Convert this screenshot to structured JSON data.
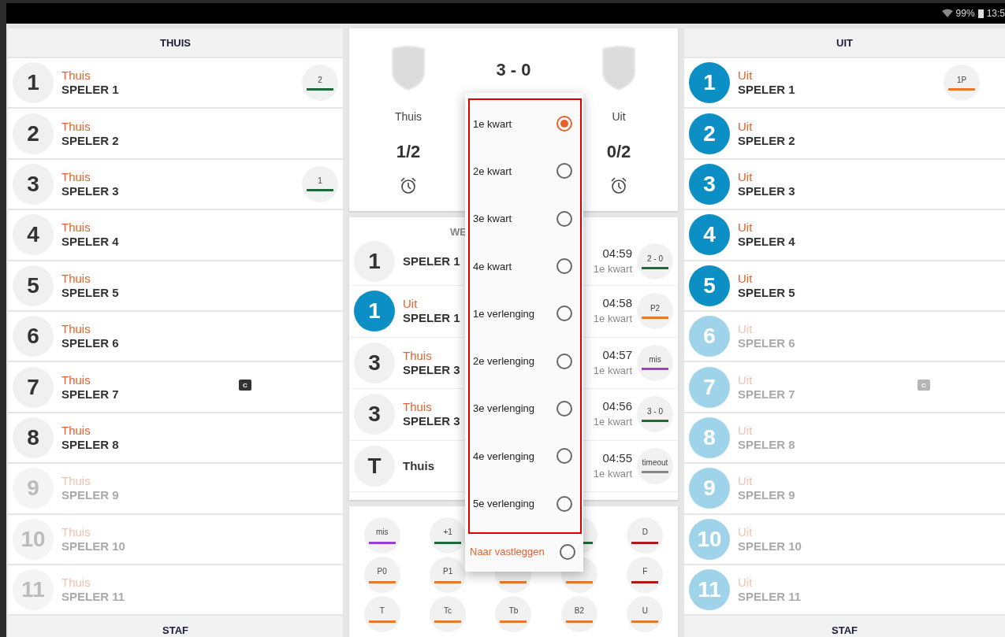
{
  "status_bar": {
    "battery": "99%",
    "time": "13:5"
  },
  "home": {
    "kind": "home",
    "title": "THUIS",
    "footer": "STAF",
    "players": [
      {
        "number": "1",
        "team": "Thuis",
        "name": "SPELER 1",
        "active": true,
        "badge": {
          "label": "2",
          "color": "#1d6b3b"
        }
      },
      {
        "number": "2",
        "team": "Thuis",
        "name": "SPELER 2",
        "active": true
      },
      {
        "number": "3",
        "team": "Thuis",
        "name": "SPELER 3",
        "active": true,
        "badge": {
          "label": "1",
          "color": "#1d6b3b"
        }
      },
      {
        "number": "4",
        "team": "Thuis",
        "name": "SPELER 4",
        "active": true
      },
      {
        "number": "5",
        "team": "Thuis",
        "name": "SPELER 5",
        "active": true
      },
      {
        "number": "6",
        "team": "Thuis",
        "name": "SPELER 6",
        "active": true
      },
      {
        "number": "7",
        "team": "Thuis",
        "name": "SPELER 7",
        "active": true,
        "captain": "C"
      },
      {
        "number": "8",
        "team": "Thuis",
        "name": "SPELER 8",
        "active": true
      },
      {
        "number": "9",
        "team": "Thuis",
        "name": "SPELER 9",
        "active": false
      },
      {
        "number": "10",
        "team": "Thuis",
        "name": "SPELER 10",
        "active": false
      },
      {
        "number": "11",
        "team": "Thuis",
        "name": "SPELER 11",
        "active": false
      }
    ]
  },
  "scoreboard": {
    "score": "3 - 0",
    "home": {
      "name": "Thuis",
      "fouls": "1/2"
    },
    "away": {
      "name": "Uit",
      "fouls": "0/2"
    }
  },
  "events": {
    "title": "WE",
    "items": [
      {
        "kind": "home",
        "number": "1",
        "name": "SPELER 1",
        "time": "04:59",
        "period": "1e kwart",
        "badge": {
          "label": "2 - 0",
          "color": "#1d6b3b"
        }
      },
      {
        "kind": "away",
        "number": "1",
        "team": "Uit",
        "name": "SPELER 1",
        "time": "04:58",
        "period": "1e kwart",
        "badge": {
          "label": "P2",
          "color": "#e8782e"
        }
      },
      {
        "kind": "home",
        "number": "3",
        "team": "Thuis",
        "name": "SPELER 3",
        "time": "04:57",
        "period": "1e kwart",
        "badge": {
          "label": "mis",
          "color": "#9a3fd0"
        }
      },
      {
        "kind": "home",
        "number": "3",
        "team": "Thuis",
        "name": "SPELER 3",
        "time": "04:56",
        "period": "1e kwart",
        "badge": {
          "label": "3 - 0",
          "color": "#1d6b3b"
        }
      },
      {
        "kind": "home",
        "number": "T",
        "name": "Thuis",
        "time": "04:55",
        "period": "1e kwart",
        "badge": {
          "label": "timeout",
          "color": "#888888"
        }
      }
    ]
  },
  "actions": [
    {
      "label": "mis",
      "color": "#9a3fd0"
    },
    {
      "label": "+1",
      "color": "#1d6b3b"
    },
    {
      "color": "#1d6b3b"
    },
    {
      "label": "D",
      "color": "#b01818"
    },
    {
      "label": "P0",
      "color": "#e8782e"
    },
    {
      "label": "P1",
      "color": "#e8782e"
    },
    {
      "color": "#e8782e"
    },
    {
      "color": "#e8782e"
    },
    {
      "label": "F",
      "color": "#b01818"
    },
    {
      "label": "T",
      "color": "#e8782e"
    },
    {
      "label": "Tc",
      "color": "#e8782e"
    },
    {
      "label": "Tb",
      "color": "#e8782e"
    },
    {
      "label": "B2",
      "color": "#e8782e"
    },
    {
      "label": "U",
      "color": "#e8782e"
    }
  ],
  "period_menu": {
    "options": [
      {
        "label": "1e kwart",
        "selected": true
      },
      {
        "label": "2e kwart",
        "selected": false
      },
      {
        "label": "3e kwart",
        "selected": false
      },
      {
        "label": "4e kwart",
        "selected": false
      },
      {
        "label": "1e verlenging",
        "selected": false
      },
      {
        "label": "2e verlenging",
        "selected": false
      },
      {
        "label": "3e verlenging",
        "selected": false
      },
      {
        "label": "4e verlenging",
        "selected": false
      },
      {
        "label": "5e verlenging",
        "selected": false
      }
    ],
    "footer": {
      "label": "Naar vastleggen",
      "selected": false
    }
  },
  "away": {
    "kind": "away",
    "title": "UIT",
    "footer": "STAF",
    "players": [
      {
        "number": "1",
        "team": "Uit",
        "name": "SPELER 1",
        "active": true,
        "badge": {
          "label": "1P",
          "color": "#e8782e"
        }
      },
      {
        "number": "2",
        "team": "Uit",
        "name": "SPELER 2",
        "active": true
      },
      {
        "number": "3",
        "team": "Uit",
        "name": "SPELER 3",
        "active": true
      },
      {
        "number": "4",
        "team": "Uit",
        "name": "SPELER 4",
        "active": true
      },
      {
        "number": "5",
        "team": "Uit",
        "name": "SPELER 5",
        "active": true
      },
      {
        "number": "6",
        "team": "Uit",
        "name": "SPELER 6",
        "active": false
      },
      {
        "number": "7",
        "team": "Uit",
        "name": "SPELER 7",
        "active": false,
        "captain": "C"
      },
      {
        "number": "8",
        "team": "Uit",
        "name": "SPELER 8",
        "active": false
      },
      {
        "number": "9",
        "team": "Uit",
        "name": "SPELER 9",
        "active": false
      },
      {
        "number": "10",
        "team": "Uit",
        "name": "SPELER 10",
        "active": false
      },
      {
        "number": "11",
        "team": "Uit",
        "name": "SPELER 11",
        "active": false
      }
    ]
  }
}
